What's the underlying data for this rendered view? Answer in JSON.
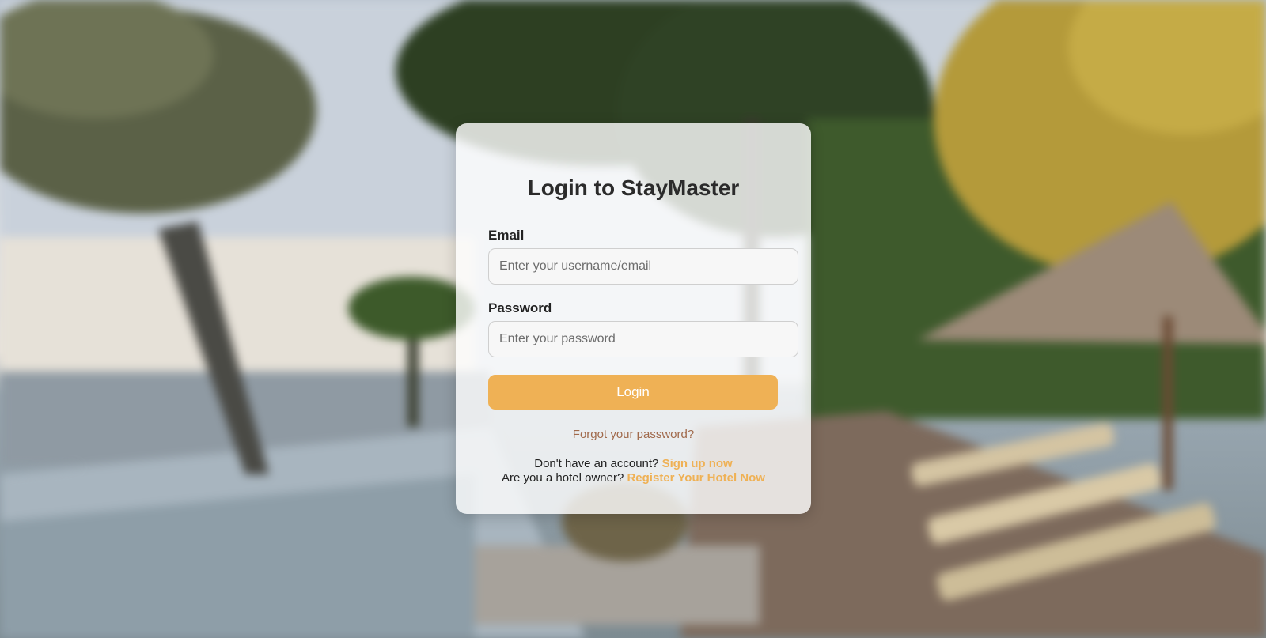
{
  "login": {
    "title": "Login to StayMaster",
    "email_label": "Email",
    "email_placeholder": "Enter your username/email",
    "email_value": "",
    "password_label": "Password",
    "password_placeholder": "Enter your password",
    "password_value": "",
    "login_button": "Login",
    "forgot_link": "Forgot your password?",
    "no_account_text": "Don't have an account?",
    "signup_link": "Sign up now",
    "hotel_owner_text": "Are you a hotel owner?",
    "register_hotel_link": "Register Your Hotel Now"
  },
  "colors": {
    "accent": "#efb155",
    "forgot_link": "#a0694a",
    "title": "#2b2b2b"
  }
}
